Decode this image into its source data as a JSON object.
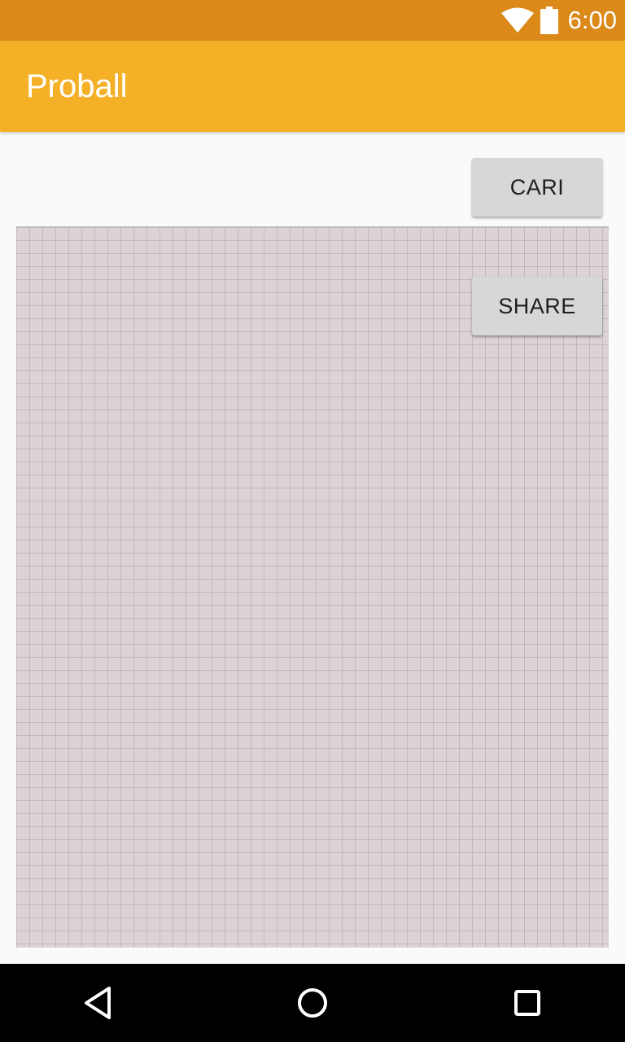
{
  "status_bar": {
    "time": "6:00",
    "icons": [
      "wifi-icon",
      "battery-icon"
    ],
    "background_color": "#db8919"
  },
  "app_bar": {
    "title": "Proball",
    "background_color": "#f4b128"
  },
  "main": {
    "cari_button_label": "CARI",
    "share_button_label": "SHARE",
    "canvas_color": "#dbd3d4"
  },
  "nav_bar": {
    "buttons": [
      "back-icon",
      "home-icon",
      "recents-icon"
    ]
  }
}
